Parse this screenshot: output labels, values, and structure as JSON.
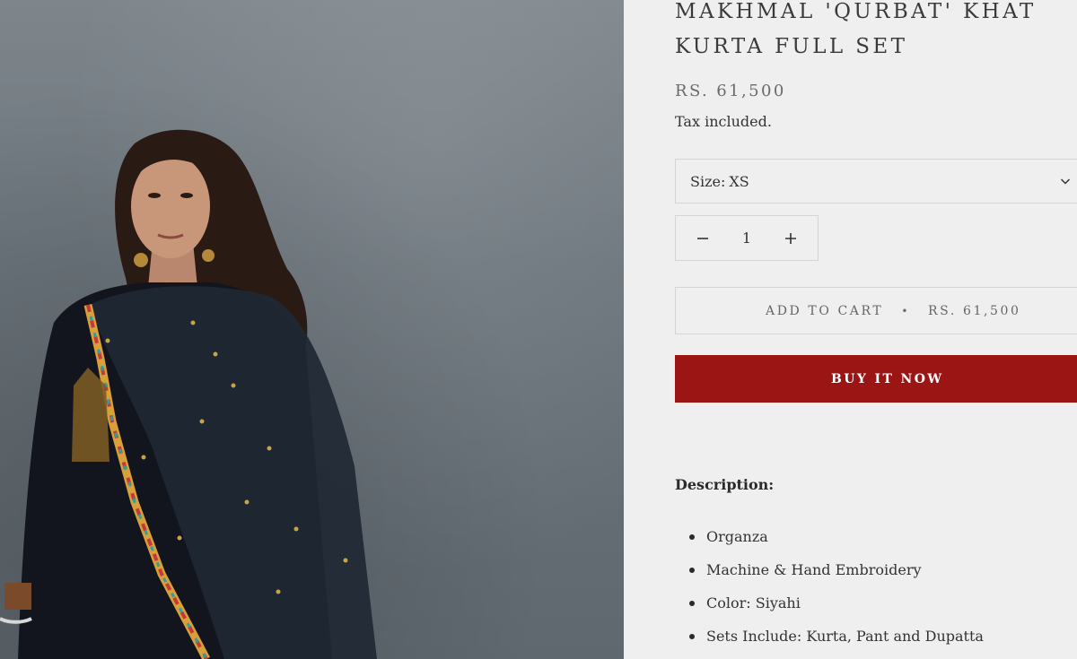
{
  "product": {
    "title": "MAKHMAL 'QURBAT' KHAT KURTA FULL SET",
    "price": "RS. 61,500",
    "tax_note": "Tax included.",
    "image_icon": "product-photo"
  },
  "size_selector": {
    "label": "Size:",
    "value": "XS",
    "icon": "chevron-down-icon"
  },
  "quantity": {
    "value": "1",
    "decrement_icon": "minus-icon",
    "increment_icon": "plus-icon"
  },
  "add_to_cart": {
    "label": "ADD TO CART",
    "separator": "•",
    "price": "RS. 61,500"
  },
  "buy_now": {
    "label": "BUY IT NOW",
    "color": "#9b1515"
  },
  "description": {
    "heading": "Description:",
    "items": [
      "Organza",
      "Machine & Hand Embroidery",
      "Color: Siyahi",
      "Sets Include: Kurta, Pant and Dupatta"
    ]
  }
}
